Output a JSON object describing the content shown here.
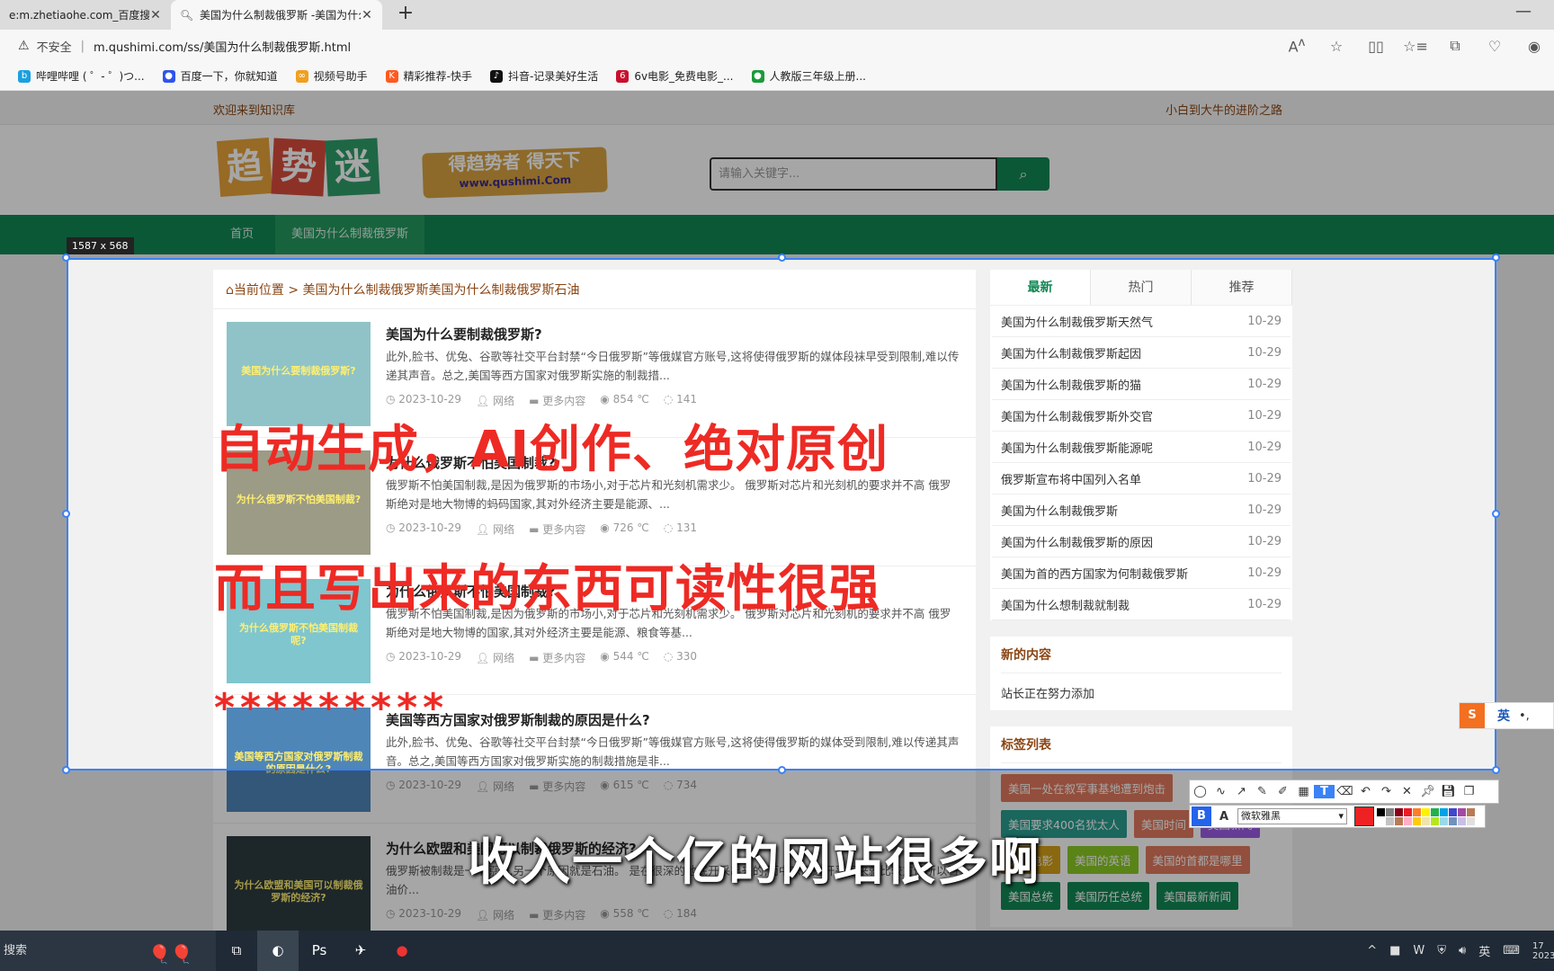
{
  "browser": {
    "tabs": [
      {
        "title": "e:m.zhetiaohe.com_百度搜索",
        "icon": "globe-icon"
      },
      {
        "title": "美国为什么制裁俄罗斯 -美国为什么制裁俄罗斯",
        "icon": "search-icon"
      }
    ],
    "new_tab": "+",
    "insecure_label": "不安全",
    "url": "m.qushimi.com/ss/美国为什么制裁俄罗斯.html",
    "bookmarks": [
      {
        "label": "哔哩哔哩 ( ゜- ゜)つ...",
        "color": "#1aa0e0"
      },
      {
        "label": "百度一下，你就知道",
        "color": "#2f54eb"
      },
      {
        "label": "视频号助手",
        "color": "#f0a020"
      },
      {
        "label": "精彩推荐-快手",
        "color": "#ff5a1f"
      },
      {
        "label": "抖音-记录美好生活",
        "color": "#111111"
      },
      {
        "label": "6v电影_免费电影_...",
        "color": "#c8102e"
      },
      {
        "label": "人教版三年级上册...",
        "color": "#1b9b3a"
      }
    ]
  },
  "site": {
    "welcome": "欢迎来到知识库",
    "motto": "小白到大牛的进阶之路",
    "logo_chars": [
      "趋",
      "势",
      "迷"
    ],
    "slogan_main": "得趋势者 得天下",
    "slogan_url": "www.qushimi.Com",
    "search_placeholder": "请输入关键字...",
    "nav": [
      "首页",
      "美国为什么制裁俄罗斯"
    ],
    "crumb_home": "当前位置",
    "crumb_path": "美国为什么制裁俄罗斯美国为什么制裁俄罗斯石油"
  },
  "articles": [
    {
      "title": "美国为什么要制裁俄罗斯?",
      "desc": "此外,脸书、优兔、谷歌等社交平台封禁“今日俄罗斯”等俄媒官方账号,这将使得俄罗斯的媒体段袜早受到限制,难以传递其声音。总之,美国等西方国家对俄罗斯实施的制裁措...",
      "date": "2023-10-29",
      "source": "网络",
      "category": "更多内容",
      "views": "854 ℃",
      "comments": "141",
      "thumb_text": "美国为什么要制裁俄罗斯?",
      "thumb_bg": "#8fc3c7"
    },
    {
      "title": "为什么俄罗斯不怕美国制裁?",
      "desc": "俄罗斯不怕美国制裁,是因为俄罗斯的市场小,对于芯片和光刻机需求少。 俄罗斯对芯片和光刻机的要求并不高 俄罗斯绝对是地大物博的蚂码国家,其对外经济主要是能源、...",
      "date": "2023-10-29",
      "source": "网络",
      "category": "更多内容",
      "views": "726 ℃",
      "comments": "131",
      "thumb_text": "为什么俄罗斯不怕美国制裁?",
      "thumb_bg": "#9b9b86"
    },
    {
      "title": "为什么俄罗斯不怕美国制裁?",
      "desc": "俄罗斯不怕美国制裁,是因为俄罗斯的市场小,对于芯片和光刻机需求少。 俄罗斯对芯片和光刻机的要求并不高 俄罗斯绝对是地大物博的国家,其对外经济主要是能源、粮食等基...",
      "date": "2023-10-29",
      "source": "网络",
      "category": "更多内容",
      "views": "544 ℃",
      "comments": "330",
      "thumb_text": "为什么俄罗斯不怕美国制裁呢?",
      "thumb_bg": "#7fc6cf"
    },
    {
      "title": "美国等西方国家对俄罗斯制裁的原因是什么?",
      "desc": "此外,脸书、优兔、谷歌等社交平台封禁“今日俄罗斯”等俄媒官方账号,这将使得俄罗斯的媒体受到限制,难以传递其声音。总之,美国等西方国家对俄罗斯实施的制裁措施是非...",
      "date": "2023-10-29",
      "source": "网络",
      "category": "更多内容",
      "views": "615 ℃",
      "comments": "734",
      "thumb_text": "美国等西方国家对俄罗斯制裁的原因是什么?",
      "thumb_bg": "#4f86b8"
    },
    {
      "title": "为什么欧盟和美国可以制裁俄罗斯的经济?",
      "desc": "俄罗斯被制裁是一个原因,另一个原因就是石油。 是在很深的地底开采出来的,而中东那边开采起来就比较方便所以石油价...",
      "date": "2023-10-29",
      "source": "网络",
      "category": "更多内容",
      "views": "558 ℃",
      "comments": "184",
      "thumb_text": "为什么欧盟和美国可以制裁俄罗斯的经济?",
      "thumb_bg": "#2d3b3f"
    }
  ],
  "sidebar": {
    "tabs": [
      "最新",
      "热门",
      "推荐"
    ],
    "items": [
      {
        "title": "美国为什么制裁俄罗斯天然气",
        "date": "10-29"
      },
      {
        "title": "美国为什么制裁俄罗斯起因",
        "date": "10-29"
      },
      {
        "title": "美国为什么制裁俄罗斯的猫",
        "date": "10-29"
      },
      {
        "title": "美国为什么制裁俄罗斯外交官",
        "date": "10-29"
      },
      {
        "title": "美国为什么制裁俄罗斯能源呢",
        "date": "10-29"
      },
      {
        "title": "俄罗斯宣布将中国列入名单",
        "date": "10-29"
      },
      {
        "title": "美国为什么制裁俄罗斯",
        "date": "10-29"
      },
      {
        "title": "美国为什么制裁俄罗斯的原因",
        "date": "10-29"
      },
      {
        "title": "美国为首的西方国家为何制裁俄罗斯",
        "date": "10-29"
      },
      {
        "title": "美国为什么想制裁就制裁",
        "date": "10-29"
      }
    ],
    "new_content_title": "新的内容",
    "new_content_text": "站长正在努力添加",
    "tags_title": "标签列表",
    "tags": [
      {
        "label": "美国一处在叙军事基地遭到炮击",
        "color": "#e07a5f"
      },
      {
        "label": "美国要求400名犹太人",
        "color": "#2a9d8f"
      },
      {
        "label": "美国时间",
        "color": "#e07a5f"
      },
      {
        "label": "美国新闻",
        "color": "#9b5de5"
      },
      {
        "label": "美国电影",
        "color": "#d4a017"
      },
      {
        "label": "美国的英语",
        "color": "#8ac926"
      },
      {
        "label": "美国的首都是哪里",
        "color": "#e07a5f"
      },
      {
        "label": "美国总统",
        "color": "#128855"
      },
      {
        "label": "美国历任总统",
        "color": "#128855"
      },
      {
        "label": "美国最新新闻",
        "color": "#128855"
      }
    ]
  },
  "overlay": {
    "selection_size": "1587 x 568",
    "caption1": "自动生成，AI创作、绝对原创",
    "caption2": "而且写出来的东西可读性很强",
    "caption3": "*********",
    "subtitle": "收入一个亿的网站很多啊"
  },
  "snip_toolbar": {
    "font_name": "微软雅黑",
    "bold_label": "B",
    "italic_label": "A",
    "text_tool": "T",
    "current_color": "#ee2222",
    "palette": [
      "#000000",
      "#7f7f7f",
      "#880015",
      "#ed1c24",
      "#ff7f27",
      "#fff200",
      "#22b14c",
      "#00a2e8",
      "#3f48cc",
      "#a349a4",
      "#b97a57",
      "#ffffff",
      "#c3c3c3",
      "#b97a57",
      "#ffaec9",
      "#ffc90e",
      "#efe4b0",
      "#b5e61d",
      "#99d9ea",
      "#7092be",
      "#c8bfe7",
      "#e0e0e0"
    ]
  },
  "ime": {
    "logo": "S",
    "lang": "英"
  },
  "taskbar": {
    "search_label": "搜索",
    "apps": [
      "task-view-icon",
      "edge-icon",
      "photoshop-icon",
      "feishu-icon",
      "recorder-icon"
    ],
    "tray_lang": "英",
    "clock_partial": "17 2023"
  }
}
